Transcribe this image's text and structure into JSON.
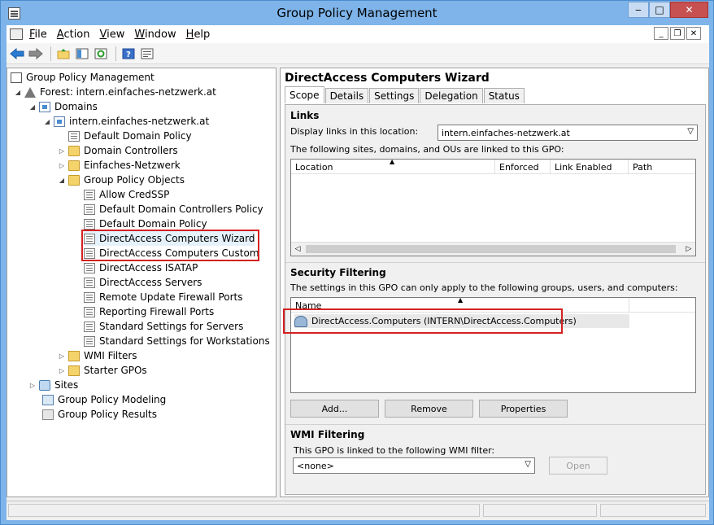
{
  "window": {
    "title": "Group Policy Management",
    "buttons": {
      "min": "‒",
      "max": "□",
      "close": "✕"
    }
  },
  "menu": {
    "items": [
      {
        "accel": "F",
        "rest": "ile"
      },
      {
        "accel": "A",
        "rest": "ction"
      },
      {
        "accel": "V",
        "rest": "iew"
      },
      {
        "accel": "W",
        "rest": "indow"
      },
      {
        "accel": "H",
        "rest": "elp"
      }
    ]
  },
  "toolbar": {
    "icons": [
      "back-icon",
      "forward-icon",
      "up-folder-icon",
      "show-hide-tree-icon",
      "refresh-icon",
      "help-icon",
      "properties-icon"
    ]
  },
  "tree": {
    "root": "Group Policy Management",
    "forest": "Forest: intern.einfaches-netzwerk.at",
    "domains": "Domains",
    "domain": "intern.einfaches-netzwerk.at",
    "default_domain_policy_link": "Default Domain Policy",
    "domain_controllers": "Domain Controllers",
    "einfaches_netzwerk": "Einfaches-Netzwerk",
    "gpo_container": "Group Policy Objects",
    "gpos": [
      "Allow CredSSP",
      "Default Domain Controllers Policy",
      "Default Domain Policy",
      "DirectAccess Computers Wizard",
      "DirectAccess Computers Custom",
      "DirectAccess ISATAP",
      "DirectAccess Servers",
      "Remote Update Firewall Ports",
      "Reporting Firewall Ports",
      "Standard Settings for Servers",
      "Standard Settings for Workstations"
    ],
    "wmi_filters": "WMI Filters",
    "starter_gpos": "Starter GPOs",
    "sites": "Sites",
    "modeling": "Group Policy Modeling",
    "results": "Group Policy Results"
  },
  "details": {
    "title": "DirectAccess Computers Wizard",
    "tabs": [
      "Scope",
      "Details",
      "Settings",
      "Delegation",
      "Status"
    ],
    "links": {
      "heading": "Links",
      "display_label": "Display links in this location:",
      "location_value": "intern.einfaches-netzwerk.at",
      "description": "The following sites, domains, and OUs are linked to this GPO:",
      "columns": [
        "Location",
        "Enforced",
        "Link Enabled",
        "Path"
      ]
    },
    "security": {
      "heading": "Security Filtering",
      "description": "The settings in this GPO can only apply to the following groups, users, and computers:",
      "column": "Name",
      "entries": [
        "DirectAccess.Computers (INTERN\\DirectAccess.Computers)"
      ],
      "add": "Add...",
      "remove": "Remove",
      "properties": "Properties"
    },
    "wmi": {
      "heading": "WMI Filtering",
      "description": "This GPO is linked to the following WMI filter:",
      "value": "<none>",
      "open": "Open"
    }
  }
}
